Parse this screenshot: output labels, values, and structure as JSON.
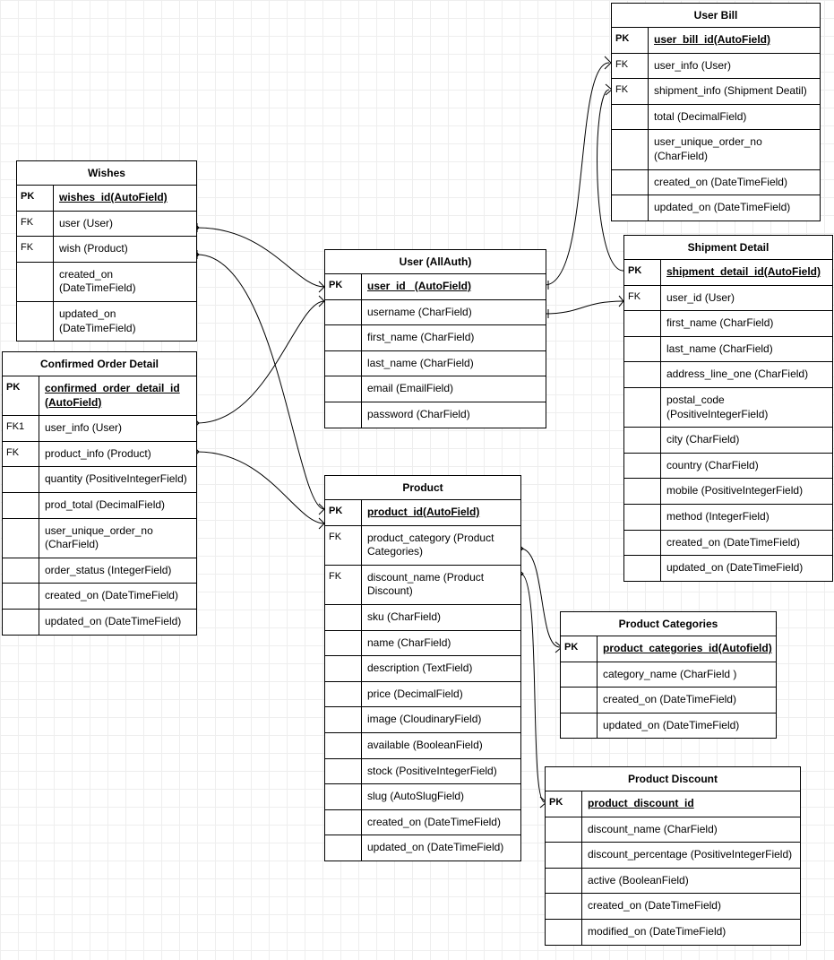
{
  "entities": {
    "wishes": {
      "title": "Wishes",
      "rows": [
        {
          "key": "PK",
          "field": "wishes_id(AutoField)",
          "pk": true
        },
        {
          "key": "FK",
          "field": "user (User)"
        },
        {
          "key": "FK",
          "field": "wish (Product)"
        },
        {
          "key": "",
          "field": "created_on (DateTimeField)"
        },
        {
          "key": "",
          "field": "updated_on (DateTimeField)"
        }
      ]
    },
    "cod": {
      "title": "Confirmed Order Detail",
      "rows": [
        {
          "key": "PK",
          "field": "confirmed_order_detail_id (AutoField)",
          "pk": true
        },
        {
          "key": "FK1",
          "field": "user_info (User)"
        },
        {
          "key": "FK",
          "field": "product_info (Product)"
        },
        {
          "key": "",
          "field": "quantity (PositiveIntegerField)"
        },
        {
          "key": "",
          "field": "prod_total (DecimalField)"
        },
        {
          "key": "",
          "field": "user_unique_order_no (CharField)"
        },
        {
          "key": "",
          "field": "order_status (IntegerField)"
        },
        {
          "key": "",
          "field": "created_on (DateTimeField)"
        },
        {
          "key": "",
          "field": "updated_on (DateTimeField)"
        }
      ]
    },
    "user": {
      "title": "User (AllAuth)",
      "rows": [
        {
          "key": "PK",
          "field": "user_id_ (AutoField)",
          "pk": true
        },
        {
          "key": "",
          "field": "username (CharField)"
        },
        {
          "key": "",
          "field": "first_name (CharField)"
        },
        {
          "key": "",
          "field": "last_name (CharField)"
        },
        {
          "key": "",
          "field": "email (EmailField)"
        },
        {
          "key": "",
          "field": "password (CharField)"
        }
      ]
    },
    "product": {
      "title": "Product",
      "rows": [
        {
          "key": "PK",
          "field": "product_id(AutoField)",
          "pk": true
        },
        {
          "key": "FK",
          "field": "product_category (Product Categories)"
        },
        {
          "key": "FK",
          "field": "discount_name (Product Discount)"
        },
        {
          "key": "",
          "field": "sku (CharField)"
        },
        {
          "key": "",
          "field": "name (CharField)"
        },
        {
          "key": "",
          "field": "description (TextField)"
        },
        {
          "key": "",
          "field": "price (DecimalField)"
        },
        {
          "key": "",
          "field": "image (CloudinaryField)"
        },
        {
          "key": "",
          "field": "available (BooleanField)"
        },
        {
          "key": "",
          "field": "stock (PositiveIntegerField)"
        },
        {
          "key": "",
          "field": "slug (AutoSlugField)"
        },
        {
          "key": "",
          "field": "created_on (DateTimeField)"
        },
        {
          "key": "",
          "field": "updated_on (DateTimeField)"
        }
      ]
    },
    "userbill": {
      "title": "User Bill",
      "rows": [
        {
          "key": "PK",
          "field": "user_bill_id(AutoField)",
          "pk": true
        },
        {
          "key": "FK",
          "field": "user_info (User)"
        },
        {
          "key": "FK",
          "field": "shipment_info (Shipment Deatil)"
        },
        {
          "key": "",
          "field": "total (DecimalField)"
        },
        {
          "key": "",
          "field": "user_unique_order_no (CharField)"
        },
        {
          "key": "",
          "field": "created_on (DateTimeField)"
        },
        {
          "key": "",
          "field": "updated_on (DateTimeField)"
        }
      ]
    },
    "shipment": {
      "title": "Shipment Detail",
      "rows": [
        {
          "key": "PK",
          "field": "shipment_detail_id(AutoField)",
          "pk": true
        },
        {
          "key": "FK",
          "field": "user_id (User)"
        },
        {
          "key": "",
          "field": "first_name (CharField)"
        },
        {
          "key": "",
          "field": "last_name (CharField)"
        },
        {
          "key": "",
          "field": "address_line_one (CharField)"
        },
        {
          "key": "",
          "field": "postal_code (PositiveIntegerField)"
        },
        {
          "key": "",
          "field": "city (CharField)"
        },
        {
          "key": "",
          "field": "country (CharField)"
        },
        {
          "key": "",
          "field": "mobile (PositiveIntegerField)"
        },
        {
          "key": "",
          "field": "method (IntegerField)"
        },
        {
          "key": "",
          "field": "created_on (DateTimeField)"
        },
        {
          "key": "",
          "field": "updated_on (DateTimeField)"
        }
      ]
    },
    "prodcat": {
      "title": "Product Categories",
      "rows": [
        {
          "key": "PK",
          "field": "product_categories_id(Autofield)",
          "pk": true
        },
        {
          "key": "",
          "field": "category_name (CharField )"
        },
        {
          "key": "",
          "field": "created_on (DateTimeField)"
        },
        {
          "key": "",
          "field": "updated_on (DateTimeField)"
        }
      ]
    },
    "proddisc": {
      "title": "Product Discount",
      "rows": [
        {
          "key": "PK",
          "field": "product_discount_id",
          "pk": true
        },
        {
          "key": "",
          "field": "discount_name (CharField)"
        },
        {
          "key": "",
          "field": "discount_percentage (PositiveIntegerField)"
        },
        {
          "key": "",
          "field": "active (BooleanField)"
        },
        {
          "key": "",
          "field": "created_on (DateTimeField)"
        },
        {
          "key": "",
          "field": "modified_on (DateTimeField)"
        }
      ]
    }
  }
}
